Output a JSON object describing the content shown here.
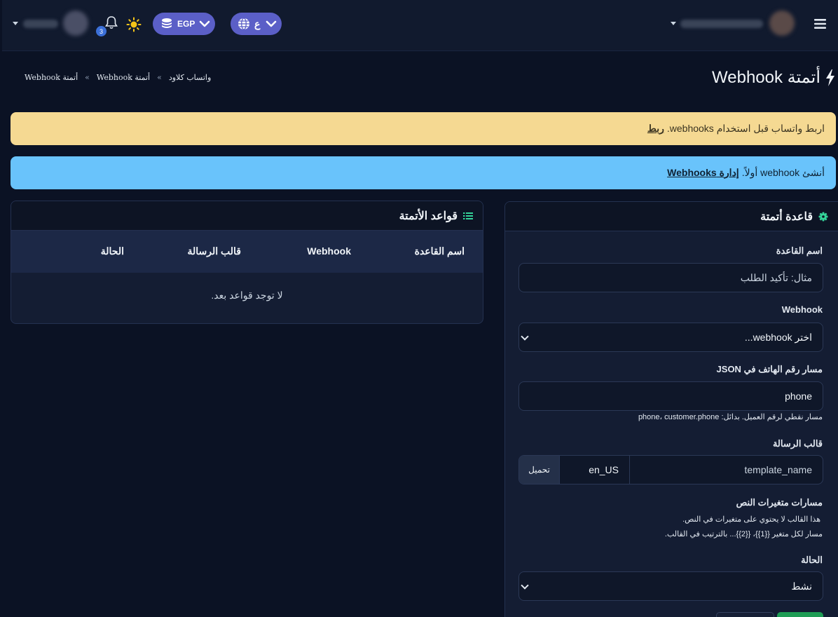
{
  "topbar": {
    "currency_label": "EGP",
    "language_label": "ع",
    "notification_count": "3"
  },
  "header": {
    "title": "أتمتة Webhook",
    "breadcrumb": [
      "واتساب كلاود",
      "أتمتة Webhook",
      "أتمتة Webhook"
    ],
    "breadcrumb_separator": "»"
  },
  "alerts": {
    "warning_text": "اربط واتساب قبل استخدام webhooks.",
    "warning_link": "ربط",
    "info_text": "أنشئ webhook أولاً.",
    "info_link": "إدارة Webhooks"
  },
  "rules_panel": {
    "title": "قواعد الأتمتة",
    "columns": [
      "اسم القاعدة",
      "Webhook",
      "قالب الرسالة",
      "الحالة"
    ],
    "empty_text": "لا توجد قواعد بعد."
  },
  "rule_form": {
    "title": "قاعدة أتمتة",
    "rule_name_label": "اسم القاعدة",
    "rule_name_placeholder": "مثال: تأكيد الطلب",
    "webhook_label": "Webhook",
    "webhook_selected": "اختر webhook...",
    "phone_path_label": "مسار رقم الهاتف في JSON",
    "phone_path_value": "phone",
    "phone_path_help": "مسار نقطي لرقم العميل. بدائل: phone، customer.phone",
    "template_label": "قالب الرسالة",
    "template_name_placeholder": "template_name",
    "template_lang_value": "en_US",
    "template_load_button": "تحميل",
    "vars_label": "مسارات متغيرات النص",
    "vars_note": "هذا القالب لا يحتوي على متغيرات في النص.",
    "vars_help": "مسار لكل متغير {{1}}، {{2}}... بالترتيب في القالب.",
    "status_label": "الحالة",
    "status_selected": "نشط"
  },
  "colors": {
    "background": "#0b1224",
    "accent": "#5b5fc7",
    "warning": "#f5d992",
    "info": "#69c3fb",
    "success": "#1f9d55"
  }
}
